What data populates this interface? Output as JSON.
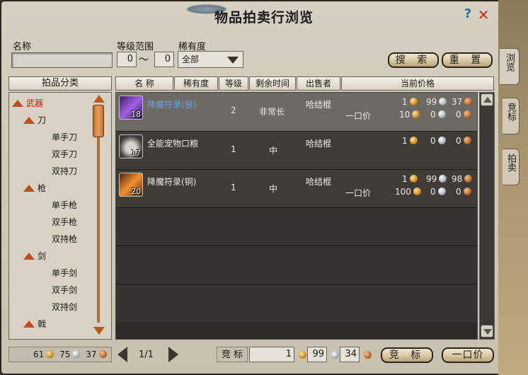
{
  "window": {
    "title": "物品拍卖行浏览"
  },
  "search": {
    "name_label": "名称",
    "name_value": "",
    "level_label": "等级范围",
    "level_min": "0",
    "level_sep": "～",
    "level_max": "0",
    "rarity_label": "稀有度",
    "rarity_value": "全部",
    "search_button": "搜 索",
    "reset_button": "重 置"
  },
  "side_tabs": [
    "浏览",
    "竞标",
    "拍卖"
  ],
  "categories": {
    "header": "拍品分类",
    "items": [
      "武器",
      "刀",
      "单手刀",
      "双手刀",
      "双持刀",
      "枪",
      "单手枪",
      "双手枪",
      "双持枪",
      "剑",
      "单手剑",
      "双手剑",
      "双持剑",
      "戟"
    ]
  },
  "table": {
    "columns": [
      "名 称",
      "稀有度",
      "等级",
      "剩余时间",
      "出售者",
      "当前价格"
    ],
    "rows": [
      {
        "name": "降魔符录(银)",
        "qty": "18",
        "level": "2",
        "time": "非常长",
        "seller": "哈结棍",
        "buyout_label": "一口价",
        "bid": [
          "1",
          "99",
          "37"
        ],
        "buyout": [
          "10",
          "0",
          "0"
        ],
        "icon": "purple-scroll-icon"
      },
      {
        "name": "全能宠物口粮",
        "qty": "17",
        "level": "1",
        "time": "中",
        "seller": "哈结棍",
        "buyout_label": "",
        "bid": [
          "1",
          "0",
          "0"
        ],
        "buyout": null,
        "icon": "pet-food-sack-icon"
      },
      {
        "name": "降魔符录(铜)",
        "qty": "20",
        "level": "1",
        "time": "中",
        "seller": "哈结棍",
        "buyout_label": "一口价",
        "bid": [
          "1",
          "99",
          "98"
        ],
        "buyout": [
          "100",
          "0",
          "0"
        ],
        "icon": "orange-scroll-icon"
      }
    ]
  },
  "footer": {
    "money": [
      "61",
      "75",
      "37"
    ],
    "page": "1/1",
    "bid_label": "竞 标",
    "bid_values": [
      "1",
      "99",
      "34"
    ],
    "bid_button": "竞 标",
    "buyout_button": "一口价"
  },
  "colors": {
    "selected_name": "#6aa0e0",
    "category_active": "#c02010",
    "row_selected": "#6d6964"
  }
}
